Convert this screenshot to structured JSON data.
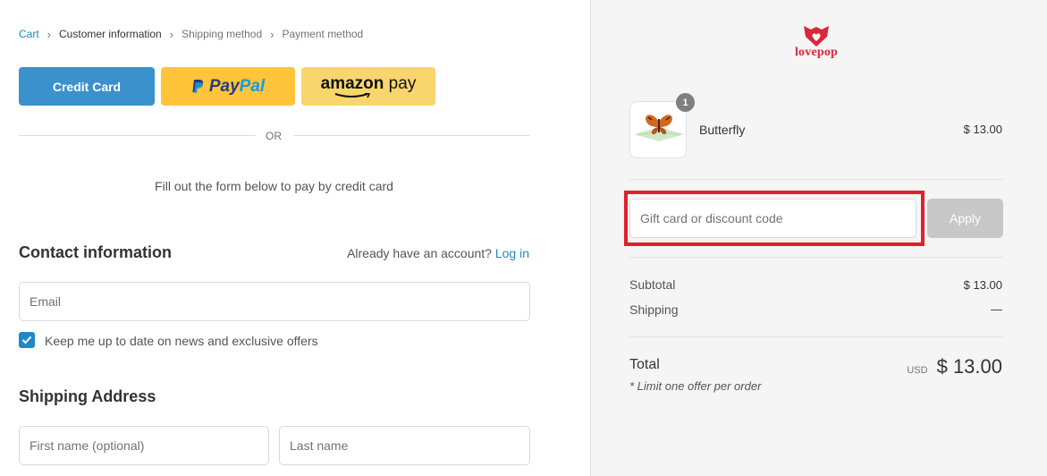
{
  "breadcrumb": {
    "items": [
      "Cart",
      "Customer information",
      "Shipping method",
      "Payment method"
    ],
    "separator": "›"
  },
  "payment_buttons": {
    "credit_card_label": "Credit Card",
    "paypal_label_1": "Pay",
    "paypal_label_2": "Pal",
    "amazon_label_1": "amazon",
    "amazon_label_2": " pay"
  },
  "divider": {
    "or_label": "OR"
  },
  "fill_text": "Fill out the form below to pay by credit card",
  "contact": {
    "title": "Contact information",
    "account_prompt": "Already have an account?",
    "login_label": "Log in",
    "email_placeholder": "Email",
    "newsletter_label": "Keep me up to date on news and exclusive offers",
    "newsletter_checked": true
  },
  "shipping": {
    "title": "Shipping Address",
    "first_name_placeholder": "First name (optional)",
    "last_name_placeholder": "Last name"
  },
  "summary": {
    "brand": "lovepop",
    "item": {
      "name": "Butterfly",
      "price": "$ 13.00",
      "quantity": "1"
    },
    "discount_placeholder": "Gift card or discount code",
    "apply_label": "Apply",
    "subtotal_label": "Subtotal",
    "subtotal_value": "$ 13.00",
    "shipping_label": "Shipping",
    "shipping_value": "—",
    "total_label": "Total",
    "total_currency": "USD",
    "total_value": "$ 13.00",
    "limit_note": "* Limit one offer per order"
  },
  "colors": {
    "accent": "#1f88c6",
    "credit_card_button": "#3b91cc",
    "paypal_button": "#ffc439",
    "amazon_button": "#f8d66d",
    "highlight": "#e0202d",
    "brand": "#d9283a"
  }
}
